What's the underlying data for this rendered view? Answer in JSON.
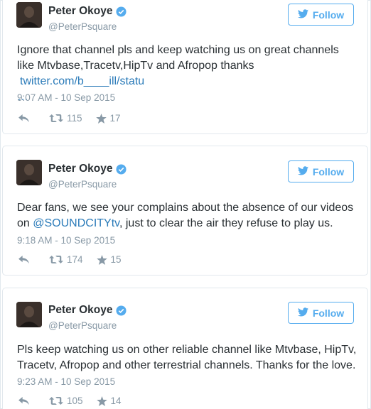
{
  "tweets": [
    {
      "name": "Peter Okoye",
      "handle": "@PeterPsquare",
      "follow_label": "Follow",
      "text_prefix": "Ignore that channel pls and keep watching us on great channels like Mtvbase,Tracetv,HipTv and Afropop thanks",
      "link": "twitter.com/b____ill/statu",
      "ellipsis": "…",
      "timestamp": "9:07 AM - 10 Sep 2015",
      "retweets": "115",
      "favorites": "17"
    },
    {
      "name": "Peter Okoye",
      "handle": "@PeterPsquare",
      "follow_label": "Follow",
      "text_prefix": "Dear fans, we see your complains about the absence of our videos on",
      "mention": "@SOUNDCITYtv",
      "text_suffix": ", just to clear the air they refuse to play us.",
      "timestamp": "9:18 AM - 10 Sep 2015",
      "retweets": "174",
      "favorites": "15"
    },
    {
      "name": "Peter Okoye",
      "handle": "@PeterPsquare",
      "follow_label": "Follow",
      "text_prefix": "Pls keep watching us on other reliable channel like Mtvbase, HipTv, Tracetv, Afropop and other terrestrial channels. Thanks for the love.",
      "timestamp": "9:23 AM - 10 Sep 2015",
      "retweets": "105",
      "favorites": "14"
    }
  ],
  "colors": {
    "accent": "#55acee",
    "link": "#2b7bb9",
    "muted": "#8899a6",
    "text": "#292f33"
  },
  "icons": [
    "avatar-photo",
    "verified-badge-icon",
    "twitter-bird-icon",
    "reply-icon",
    "retweet-icon",
    "favorite-star-icon"
  ]
}
